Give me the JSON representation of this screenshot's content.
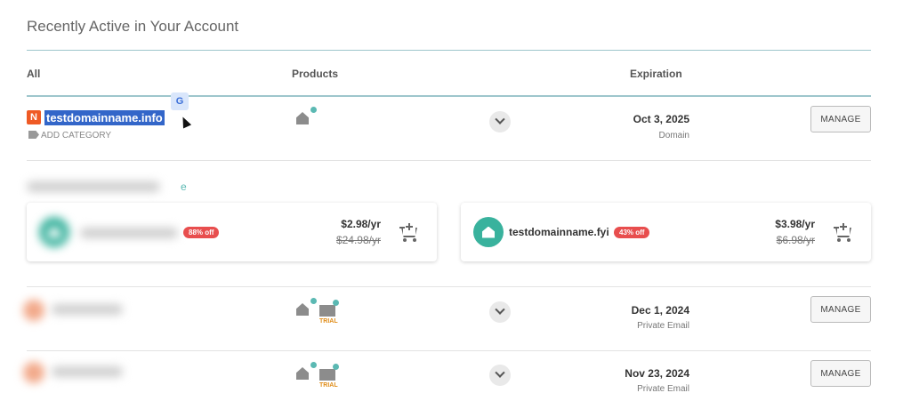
{
  "section_title": "Recently Active in Your Account",
  "columns": {
    "all": "All",
    "products": "Products",
    "expiration": "Expiration"
  },
  "colors": {
    "accent": "#9ec6cc",
    "teal": "#39b29d",
    "badge_red": "#e84e4e",
    "brand_orange": "#ef5a25",
    "selection": "#3366c9"
  },
  "rows": [
    {
      "domain": "testdomainname.info",
      "add_category": "ADD CATEGORY",
      "products": [
        "hosting-icon"
      ],
      "date": "Oct 3, 2025",
      "type": "Domain",
      "manage": "MANAGE"
    },
    {
      "domain": "",
      "products": [
        "hosting-icon",
        "email-trial-icon"
      ],
      "trial": "TRIAL",
      "date": "Dec 1, 2024",
      "type": "Private Email",
      "manage": "MANAGE"
    },
    {
      "domain": "",
      "products": [
        "hosting-icon",
        "email-trial-icon"
      ],
      "trial": "TRIAL",
      "date": "Nov 23, 2024",
      "type": "Private Email",
      "manage": "MANAGE"
    }
  ],
  "suggestions": {
    "link_text": "e",
    "cards": [
      {
        "name": "",
        "discount": "88% off",
        "price": "$2.98/yr",
        "old_price": "$24.98/yr"
      },
      {
        "name": "testdomainname.fyi",
        "discount": "43% off",
        "price": "$3.98/yr",
        "old_price": "$6.98/yr"
      }
    ]
  }
}
